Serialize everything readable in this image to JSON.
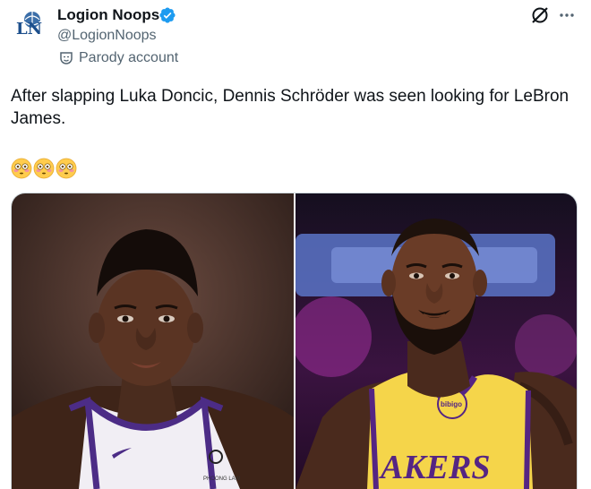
{
  "author": {
    "display_name": "Logion Noops",
    "handle": "@LogionNoops",
    "label": "Parody account",
    "avatar_letters": "LN"
  },
  "tweet": {
    "text": "After slapping Luka Doncic, Dennis Schröder was seen looking for LeBron James.",
    "emojis": [
      "flushed-face",
      "flushed-face",
      "flushed-face"
    ]
  },
  "media": {
    "left_photo": {
      "jersey_logo": "PHOONG LAW"
    },
    "right_photo": {
      "jersey_text": "AKERS",
      "patch_text": "bibigo"
    }
  },
  "colors": {
    "verified": "#1d9bf0",
    "secondary_text": "#536471",
    "lakers_gold": "#f5d54a",
    "lakers_purple": "#552583"
  },
  "icons": [
    "verified-badge-icon",
    "parody-mask-icon",
    "grok-icon",
    "more-icon"
  ]
}
